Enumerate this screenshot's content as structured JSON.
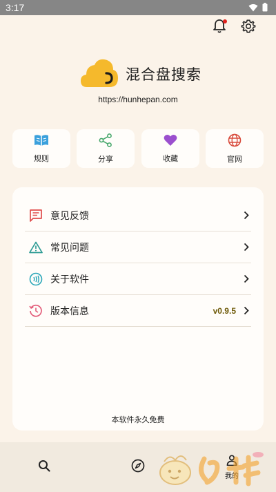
{
  "status_bar": {
    "time": "3:17"
  },
  "app": {
    "title": "混合盘搜索",
    "url": "https://hunhepan.com"
  },
  "quick_actions": [
    {
      "label": "规则",
      "icon": "book-icon"
    },
    {
      "label": "分享",
      "icon": "share-icon"
    },
    {
      "label": "收藏",
      "icon": "heart-icon"
    },
    {
      "label": "官网",
      "icon": "globe-icon"
    }
  ],
  "menu": {
    "items": [
      {
        "label": "意见反馈",
        "icon": "feedback-icon"
      },
      {
        "label": "常见问题",
        "icon": "warning-icon"
      },
      {
        "label": "关于软件",
        "icon": "nfc-icon"
      },
      {
        "label": "版本信息",
        "icon": "history-icon",
        "value": "v0.9.5"
      }
    ],
    "footer": "本软件永久免费"
  },
  "bottom_nav": {
    "items": [
      {
        "label": "",
        "icon": "search-icon"
      },
      {
        "label": "",
        "icon": "compass-icon"
      },
      {
        "label": "我的",
        "icon": "person-icon",
        "active": true
      }
    ]
  },
  "colors": {
    "background": "#fbf3e9",
    "card": "#fffdfa",
    "status_bar": "#868686",
    "notification_dot": "#e0221e",
    "logo_yellow": "#f5b92c",
    "book_blue": "#3aa0dc",
    "share_green": "#46a76b",
    "heart_purple": "#9b4fce",
    "globe_red": "#d84b3c",
    "feedback_red": "#e04b4b",
    "warning_teal": "#2d9b94",
    "nfc_teal": "#2aa6b8",
    "history_pink": "#e35d7a",
    "version_olive": "#6e5a08"
  }
}
